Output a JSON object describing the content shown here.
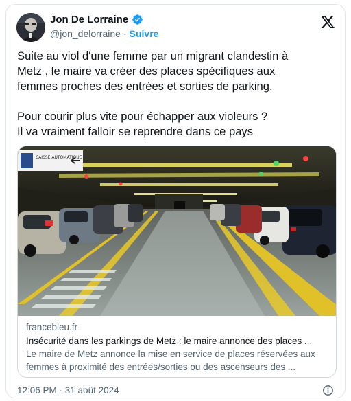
{
  "author": {
    "name": "Jon De Lorraine",
    "handle": "@jon_delorraine",
    "separator": "·",
    "follow_label": "Suivre",
    "verified_icon": "verified-badge-icon",
    "avatar_icon": "avatar"
  },
  "platform_icon": "x-logo-icon",
  "tweet": {
    "lines": [
      "Suite au viol d'une femme par un migrant clandestin à",
      "Metz , le maire va créer des places spécifiques aux",
      "femmes proches des entrées et sorties de parking.",
      "Pour courir plus vite pour échapper aux violeurs ?",
      "Il va vraiment falloir se reprendre dans ce pays"
    ]
  },
  "link_card": {
    "image_sign": "CAISSE AUTOMATIQUE",
    "domain": "francebleu.fr",
    "title": "Insécurité dans les parkings de Metz : le maire annonce des places ...",
    "description_lines": [
      "Le maire de Metz annonce la mise en service de places réservées aux",
      "femmes à proximité des entrées/sorties ou des ascenseurs des ..."
    ]
  },
  "footer": {
    "timestamp": "12:06 PM · 31 août 2024",
    "info_icon": "info-icon"
  },
  "colors": {
    "accent": "#1d9bf0",
    "text": "#0f1419",
    "secondary": "#536471",
    "border": "#cfd9de"
  }
}
